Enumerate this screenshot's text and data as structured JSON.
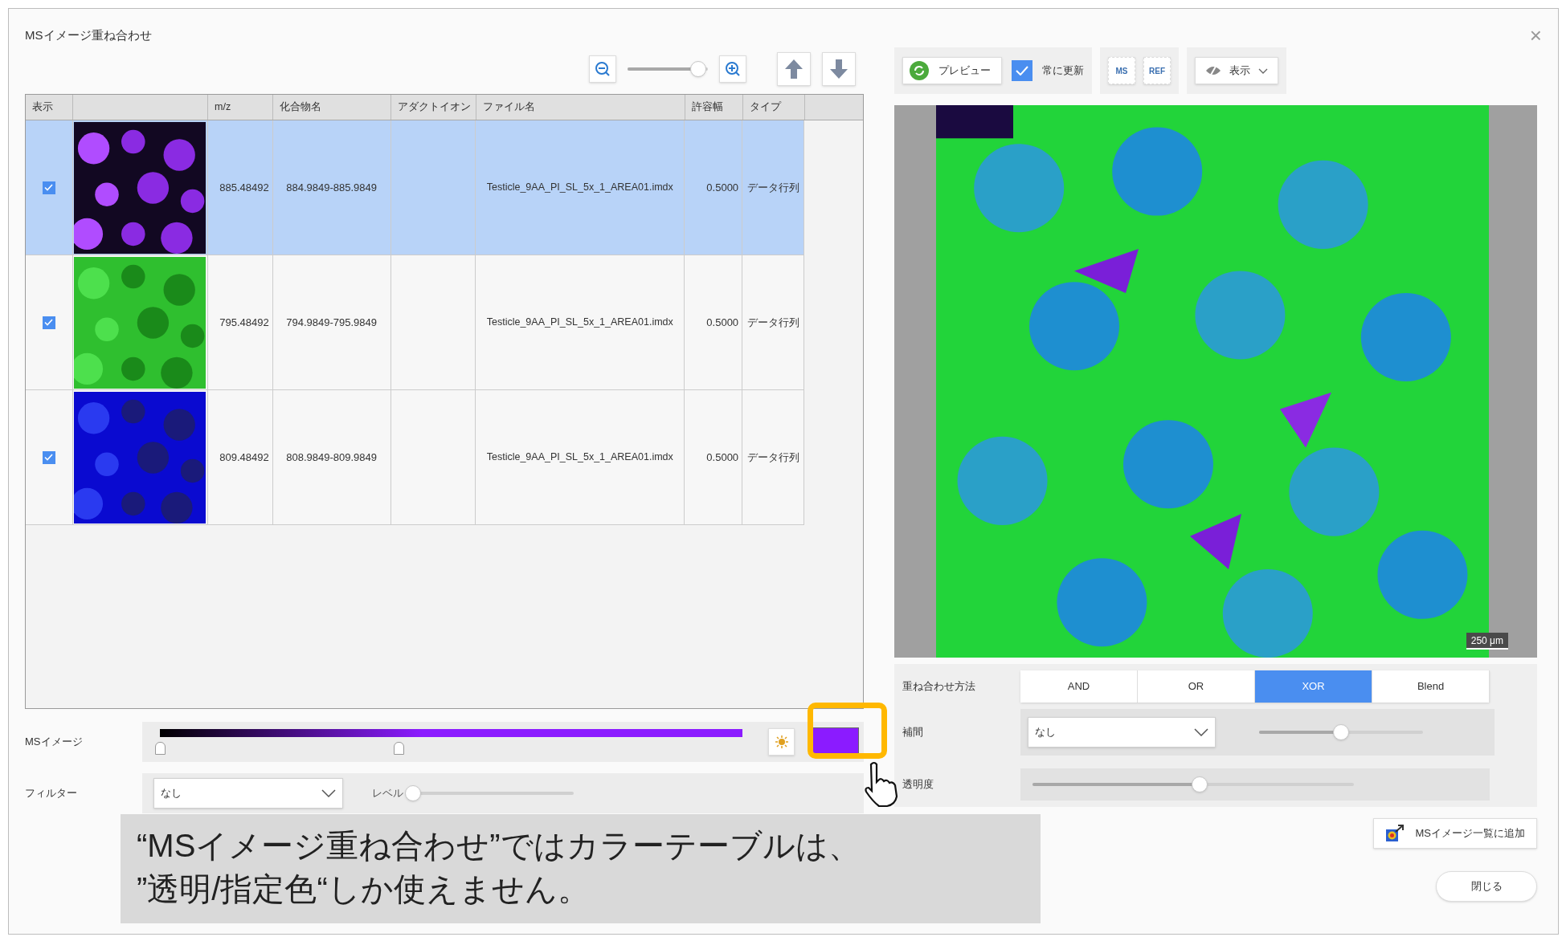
{
  "window": {
    "title": "MSイメージ重ね合わせ",
    "close": "×"
  },
  "zoom": {
    "level": 0.88
  },
  "table": {
    "columns": [
      {
        "kind": "text",
        "label": "表示"
      },
      {
        "kind": "picture"
      },
      {
        "kind": "text",
        "label": "m/z"
      },
      {
        "kind": "text",
        "label": "化合物名"
      },
      {
        "kind": "text",
        "label": "アダクトイオン"
      },
      {
        "kind": "text",
        "label": "ファイル名"
      },
      {
        "kind": "text",
        "label": "許容幅"
      },
      {
        "kind": "text",
        "label": "タイプ"
      }
    ],
    "rows": [
      {
        "selected": true,
        "checked": true,
        "picture": {
          "kind": "picture"
        },
        "mz": "885.48492",
        "compound": "884.9849-885.9849",
        "file": "Testicle_9AA_PI_SL_5x_1_AREA01.imdx",
        "tolerance": "0.5000",
        "type": "データ行列"
      },
      {
        "selected": false,
        "checked": true,
        "picture": {
          "kind": "picture"
        },
        "mz": "795.48492",
        "compound": "794.9849-795.9849",
        "file": "Testicle_9AA_PI_SL_5x_1_AREA01.imdx",
        "tolerance": "0.5000",
        "type": "データ行列"
      },
      {
        "selected": false,
        "checked": true,
        "picture": {
          "kind": "picture"
        },
        "mz": "809.48492",
        "compound": "808.9849-809.9849",
        "file": "Testicle_9AA_PI_SL_5x_1_AREA01.imdx",
        "tolerance": "0.5000",
        "type": "データ行列"
      }
    ]
  },
  "ms_image": {
    "label": "MSイメージ",
    "color": "#8b1bff",
    "low": {
      "level": 0.0
    },
    "high": {
      "level": 0.41
    }
  },
  "filter": {
    "label": "フィルター",
    "value": "なし",
    "level_label": "レベル",
    "level": 0.0
  },
  "preview_toolbar": {
    "preview": "プレビュー",
    "always_update": {
      "label": "常に更新",
      "checked": true
    },
    "ms": "MS",
    "ref": "REF",
    "display": "表示"
  },
  "preview": {
    "scale_bar": "250 μm"
  },
  "overlay_method": {
    "label": "重ね合わせ方法",
    "options": [
      {
        "label": "AND",
        "selected": false
      },
      {
        "label": "OR",
        "selected": false
      },
      {
        "label": "XOR",
        "selected": true
      },
      {
        "label": "Blend",
        "selected": false
      }
    ]
  },
  "interpolation": {
    "label": "補間",
    "value": "なし",
    "level": 0.5
  },
  "transparency": {
    "label": "透明度",
    "level": 0.52
  },
  "add_button": "MSイメージ一覧に追加",
  "close_button": "閉じる",
  "annotation": {
    "lines": [
      "“MSイメージ重ね合わせ”ではカラーテーブルは、",
      "”透明/指定色“しか使えません。"
    ]
  }
}
